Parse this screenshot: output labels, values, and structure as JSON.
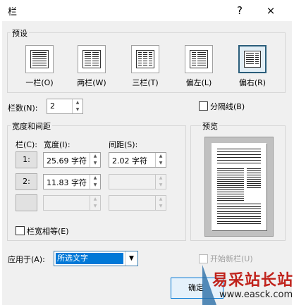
{
  "title": "栏",
  "help_glyph": "?",
  "close_glyph": "×",
  "presets": {
    "group_label": "预设",
    "items": [
      {
        "label": "一栏(O)",
        "cols": 1,
        "selected": false
      },
      {
        "label": "两栏(W)",
        "cols": 2,
        "selected": false
      },
      {
        "label": "三栏(T)",
        "cols": 3,
        "selected": false
      },
      {
        "label": "偏左(L)",
        "cols": 2,
        "selected": false
      },
      {
        "label": "偏右(R)",
        "cols": 2,
        "selected": true
      }
    ]
  },
  "num_cols": {
    "label": "栏数(N):",
    "value": "2"
  },
  "separator": {
    "label": "分隔线(B)",
    "checked": false
  },
  "width_spacing": {
    "group_label": "宽度和间距",
    "hdr_col": "栏(C):",
    "hdr_width": "宽度(I):",
    "hdr_spacing": "间距(S):",
    "rows": [
      {
        "num": "1:",
        "width": "25.69 字符",
        "spacing": "2.02 字符"
      },
      {
        "num": "2:",
        "width": "11.83 字符",
        "spacing": ""
      },
      {
        "num": "",
        "width": "",
        "spacing": ""
      }
    ]
  },
  "equal_width": {
    "label": "栏宽相等(E)",
    "checked": false
  },
  "preview": {
    "label": "预览"
  },
  "apply_to": {
    "label": "应用于(A):",
    "value": "所选文字"
  },
  "new_column": {
    "label": "开始新栏(U)",
    "checked": false
  },
  "ok_button": "确定",
  "watermark": {
    "text": "易采站长站",
    "url": "www.easck.com"
  }
}
